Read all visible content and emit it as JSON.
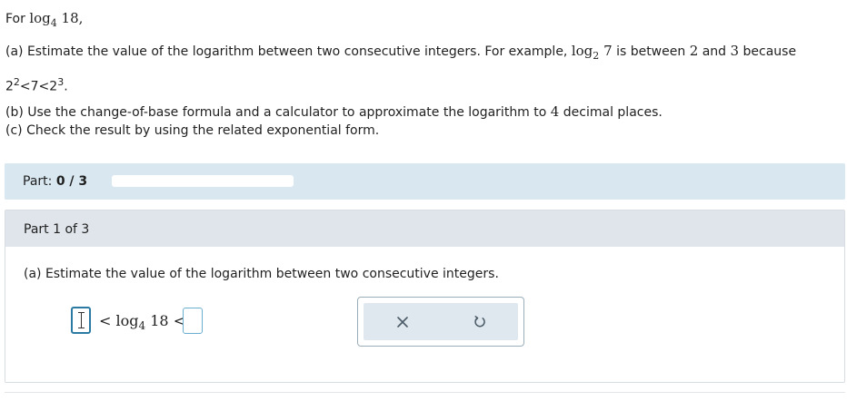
{
  "problem": {
    "intro_prefix": "For",
    "log_word": "log",
    "log_base": "4",
    "log_arg": "18,",
    "a_text": "(a) Estimate the value of the logarithm between two consecutive integers. For example,",
    "example_base": "2",
    "example_arg": "7",
    "a_mid": "is between",
    "lower": "2",
    "and_word": "and",
    "upper": "3",
    "because_word": "because",
    "ineq_left": "2",
    "ineq_left_exp": "2",
    "ineq_mid": "<7<",
    "ineq_right": "2",
    "ineq_right_exp": "3",
    "ineq_end": ".",
    "b_prefix": "(b) Use the change-of-base formula and a calculator to approximate the logarithm to",
    "b_places": "4",
    "b_suffix": "decimal places.",
    "c_text": "(c) Check the result by using the related exponential form."
  },
  "part_bar": {
    "label": "Part:",
    "score": "0 / 3",
    "progress": 0
  },
  "part_panel": {
    "header": "Part 1 of 3",
    "question": "(a) Estimate the value of the logarithm between two consecutive integers.",
    "answer": {
      "lt1": "<",
      "log_word": "log",
      "log_base": "4",
      "log_arg": "18",
      "lt2": "<",
      "left_value": "",
      "right_value": ""
    }
  },
  "tools": {
    "clear_icon": "close-icon",
    "undo_icon": "undo-icon",
    "accent": "#3b8bb5"
  }
}
